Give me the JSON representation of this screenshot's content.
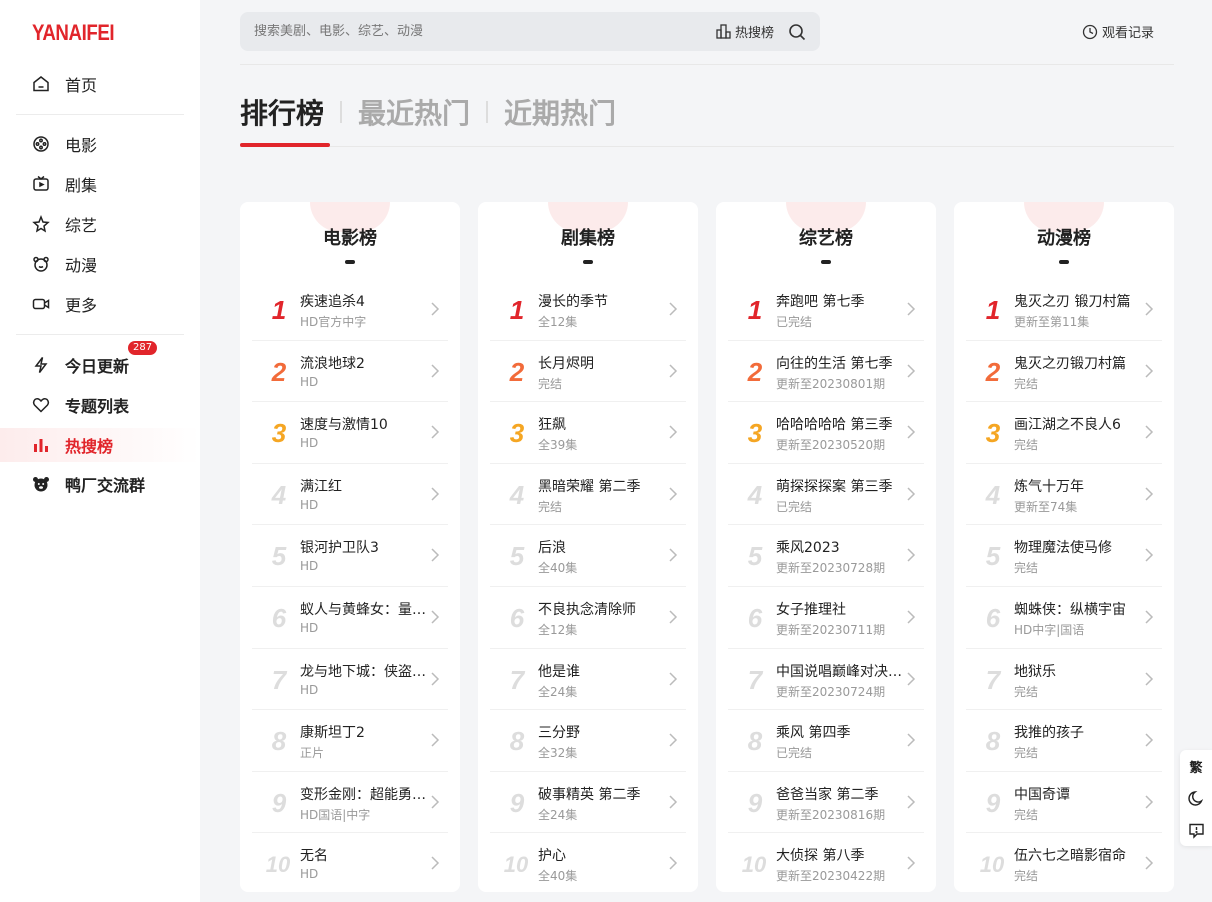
{
  "logo": "YANAIFEI",
  "sidebar": {
    "items": [
      {
        "label": "首页",
        "icon": "home-icon"
      },
      {
        "label": "电影",
        "icon": "film-reel-icon"
      },
      {
        "label": "剧集",
        "icon": "tv-icon"
      },
      {
        "label": "综艺",
        "icon": "star-icon"
      },
      {
        "label": "动漫",
        "icon": "bear-face-icon"
      },
      {
        "label": "更多",
        "icon": "video-camera-icon"
      },
      {
        "label": "今日更新",
        "icon": "lightning-icon",
        "badge": "287"
      },
      {
        "label": "专题列表",
        "icon": "heart-icon"
      },
      {
        "label": "热搜榜",
        "icon": "bar-chart-icon",
        "active": true
      },
      {
        "label": "鸭厂交流群",
        "icon": "bear-icon"
      }
    ]
  },
  "search": {
    "placeholder": "搜索美剧、电影、综艺、动漫",
    "hot_label": "热搜榜"
  },
  "history_label": "观看记录",
  "tabs": [
    "排行榜",
    "最近热门",
    "近期热门"
  ],
  "boards": [
    {
      "title": "电影榜",
      "items": [
        {
          "rank": "1",
          "title": "疾速追杀4",
          "sub": "HD官方中字"
        },
        {
          "rank": "2",
          "title": "流浪地球2",
          "sub": "HD"
        },
        {
          "rank": "3",
          "title": "速度与激情10",
          "sub": "HD"
        },
        {
          "rank": "4",
          "title": "满江红",
          "sub": "HD"
        },
        {
          "rank": "5",
          "title": "银河护卫队3",
          "sub": "HD"
        },
        {
          "rank": "6",
          "title": "蚁人与黄蜂女：量子…",
          "sub": "HD"
        },
        {
          "rank": "7",
          "title": "龙与地下城：侠盗荣耀",
          "sub": "HD"
        },
        {
          "rank": "8",
          "title": "康斯坦丁2",
          "sub": "正片"
        },
        {
          "rank": "9",
          "title": "变形金刚：超能勇士…",
          "sub": "HD国语|中字"
        },
        {
          "rank": "10",
          "title": "无名",
          "sub": "HD"
        }
      ]
    },
    {
      "title": "剧集榜",
      "items": [
        {
          "rank": "1",
          "title": "漫长的季节",
          "sub": "全12集"
        },
        {
          "rank": "2",
          "title": "长月烬明",
          "sub": "完结"
        },
        {
          "rank": "3",
          "title": "狂飙",
          "sub": "全39集"
        },
        {
          "rank": "4",
          "title": "黑暗荣耀 第二季",
          "sub": "完结"
        },
        {
          "rank": "5",
          "title": "后浪",
          "sub": "全40集"
        },
        {
          "rank": "6",
          "title": "不良执念清除师",
          "sub": "全12集"
        },
        {
          "rank": "7",
          "title": "他是谁",
          "sub": "全24集"
        },
        {
          "rank": "8",
          "title": "三分野",
          "sub": "全32集"
        },
        {
          "rank": "9",
          "title": "破事精英 第二季",
          "sub": "全24集"
        },
        {
          "rank": "10",
          "title": "护心",
          "sub": "全40集"
        }
      ]
    },
    {
      "title": "综艺榜",
      "items": [
        {
          "rank": "1",
          "title": "奔跑吧 第七季",
          "sub": "已完结"
        },
        {
          "rank": "2",
          "title": "向往的生活 第七季",
          "sub": "更新至20230801期"
        },
        {
          "rank": "3",
          "title": "哈哈哈哈哈 第三季",
          "sub": "更新至20230520期"
        },
        {
          "rank": "4",
          "title": "萌探探探案 第三季",
          "sub": "已完结"
        },
        {
          "rank": "5",
          "title": "乘风2023",
          "sub": "更新至20230728期"
        },
        {
          "rank": "6",
          "title": "女子推理社",
          "sub": "更新至20230711期"
        },
        {
          "rank": "7",
          "title": "中国说唱巅峰对决20…",
          "sub": "更新至20230724期"
        },
        {
          "rank": "8",
          "title": "乘风 第四季",
          "sub": "已完结"
        },
        {
          "rank": "9",
          "title": "爸爸当家 第二季",
          "sub": "更新至20230816期"
        },
        {
          "rank": "10",
          "title": "大侦探 第八季",
          "sub": "更新至20230422期"
        }
      ]
    },
    {
      "title": "动漫榜",
      "items": [
        {
          "rank": "1",
          "title": "鬼灭之刃 锻刀村篇",
          "sub": "更新至第11集"
        },
        {
          "rank": "2",
          "title": "鬼灭之刃锻刀村篇",
          "sub": "完结"
        },
        {
          "rank": "3",
          "title": "画江湖之不良人6",
          "sub": "完结"
        },
        {
          "rank": "4",
          "title": "炼气十万年",
          "sub": "更新至74集"
        },
        {
          "rank": "5",
          "title": "物理魔法使马修",
          "sub": "完结"
        },
        {
          "rank": "6",
          "title": "蜘蛛侠：纵横宇宙",
          "sub": "HD中字|国语"
        },
        {
          "rank": "7",
          "title": "地狱乐",
          "sub": "完结"
        },
        {
          "rank": "8",
          "title": "我推的孩子",
          "sub": "完结"
        },
        {
          "rank": "9",
          "title": "中国奇谭",
          "sub": "完结"
        },
        {
          "rank": "10",
          "title": "伍六七之暗影宿命",
          "sub": "完结"
        }
      ]
    }
  ],
  "float_buttons": {
    "traditional": "繁",
    "dark_mode_icon": "moon-icon",
    "feedback_icon": "feedback-icon"
  },
  "colors": {
    "accent": "#e1252b",
    "rank2": "#f26b3a",
    "rank3": "#f5a623",
    "rank_other": "#dddddd"
  }
}
